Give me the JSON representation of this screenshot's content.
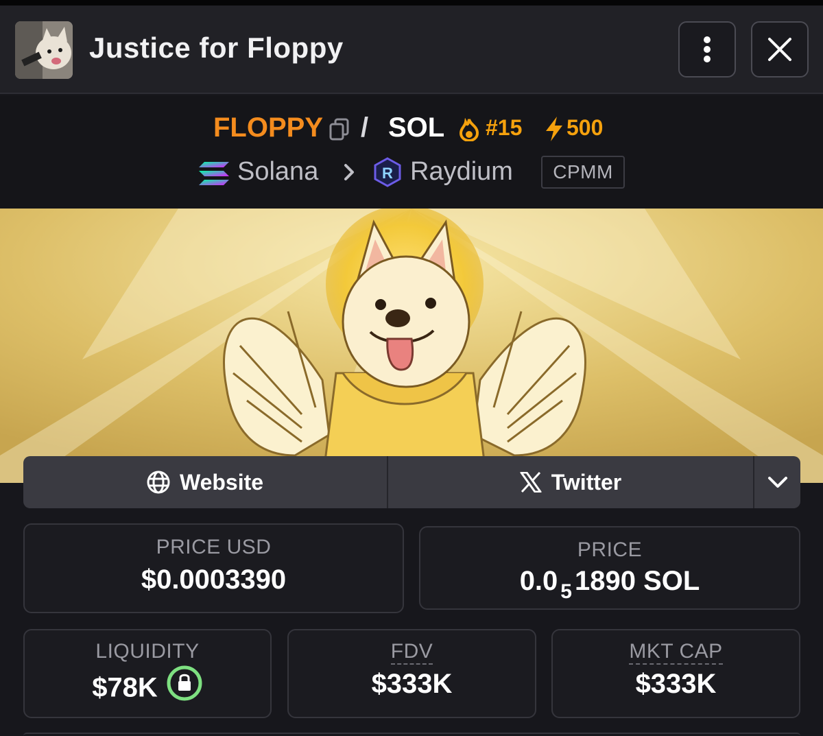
{
  "header": {
    "title": "Justice for Floppy",
    "avatar_icon": "dog-photo-avatar",
    "menu_icon": "more-vertical-icon",
    "close_icon": "close-icon"
  },
  "pair": {
    "base_symbol": "FLOPPY",
    "separator": "/",
    "quote_symbol": "SOL",
    "trending_rank": "#15",
    "boosts": "500",
    "base_color": "#f48c1e",
    "badge_color": "#f5a10d"
  },
  "chain": {
    "name": "Solana",
    "dex": "Raydium",
    "dex_type": "CPMM"
  },
  "banner": {
    "image": "angel-dog-with-halo-and-wings"
  },
  "links": {
    "website": "Website",
    "twitter": "Twitter"
  },
  "stats": {
    "price_usd_label": "PRICE USD",
    "price_usd_value": "$0.0003390",
    "price_label": "PRICE",
    "price_native_prefix": "0.0",
    "price_native_zeros": "5",
    "price_native_digits": "1890 SOL",
    "liquidity_label": "LIQUIDITY",
    "liquidity_value": "$78K",
    "fdv_label": "FDV",
    "fdv_value": "$333K",
    "mktcap_label": "MKT CAP",
    "mktcap_value": "$333K"
  }
}
